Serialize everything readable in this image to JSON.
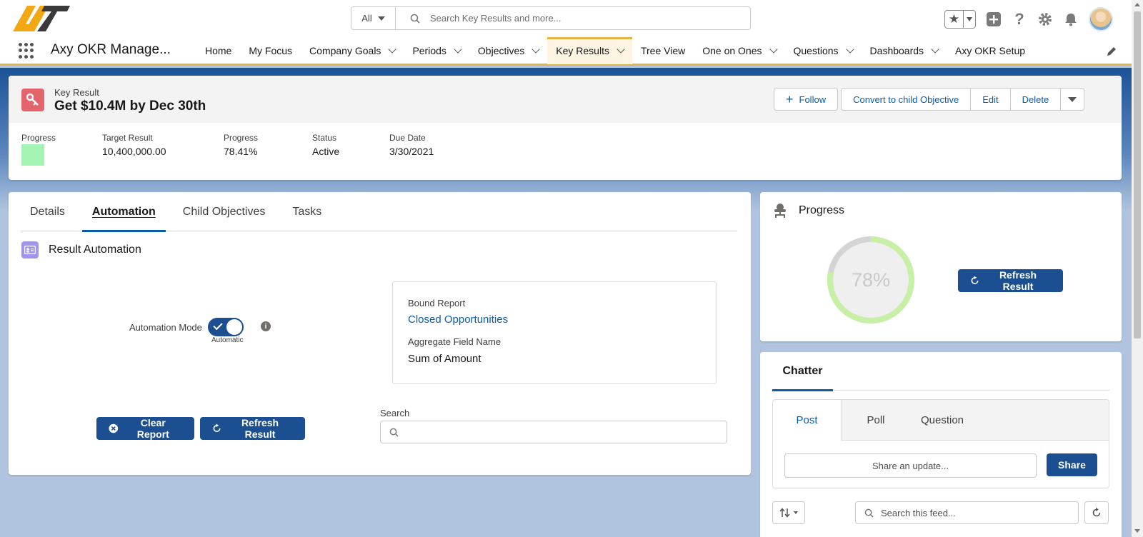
{
  "header": {
    "search_scope": "All",
    "search_placeholder": "Search Key Results and more...",
    "icons": [
      "favorites-star-icon",
      "add-icon",
      "help-icon",
      "setup-gear-icon",
      "notifications-bell-icon",
      "user-avatar"
    ]
  },
  "nav": {
    "app_name": "Axy OKR Manage...",
    "items": [
      {
        "label": "Home",
        "dropdown": false
      },
      {
        "label": "My Focus",
        "dropdown": false
      },
      {
        "label": "Company Goals",
        "dropdown": true
      },
      {
        "label": "Periods",
        "dropdown": true
      },
      {
        "label": "Objectives",
        "dropdown": true
      },
      {
        "label": "Key Results",
        "dropdown": true,
        "active": true
      },
      {
        "label": "Tree View",
        "dropdown": false
      },
      {
        "label": "One on Ones",
        "dropdown": true
      },
      {
        "label": "Questions",
        "dropdown": true
      },
      {
        "label": "Dashboards",
        "dropdown": true
      },
      {
        "label": "Axy OKR Setup",
        "dropdown": false
      }
    ]
  },
  "record": {
    "object_label": "Key Result",
    "title": "Get $10.4M by Dec 30th",
    "actions": {
      "follow": "Follow",
      "convert": "Convert to child Objective",
      "edit": "Edit",
      "delete": "Delete"
    },
    "highlights": {
      "progress_label": "Progress",
      "progress_color": "#a4f4b4",
      "target_label": "Target Result",
      "target_value": "10,400,000.00",
      "progress2_label": "Progress",
      "progress2_value": "78.41%",
      "status_label": "Status",
      "status_value": "Active",
      "due_label": "Due Date",
      "due_value": "3/30/2021"
    }
  },
  "main": {
    "tabs": [
      "Details",
      "Automation",
      "Child Objectives",
      "Tasks"
    ],
    "active_tab": "Automation",
    "section_title": "Result Automation",
    "automation_mode_label": "Automation Mode",
    "automation_mode_on": true,
    "automation_mode_caption": "Automatic",
    "bound_report_label": "Bound Report",
    "bound_report_value": "Closed Opportunities",
    "aggregate_label": "Aggregate Field Name",
    "aggregate_value": "Sum of Amount",
    "clear_report": "Clear Report",
    "refresh_result": "Refresh Result",
    "search_label": "Search",
    "search_placeholder": ""
  },
  "progress_card": {
    "title": "Progress",
    "percent_label": "78%",
    "percent": 78,
    "ring_color": "#c7efa6",
    "track_color": "#d4d4d4",
    "refresh_result": "Refresh Result"
  },
  "chatter": {
    "title": "Chatter",
    "publisher_tabs": [
      "Post",
      "Poll",
      "Question"
    ],
    "share_placeholder": "Share an update...",
    "share_button": "Share",
    "feed_search_placeholder": "Search this feed..."
  },
  "colors": {
    "brand": "#1b4f91",
    "link": "#0b5cab",
    "nav_accent": "#e3b44a",
    "key_result_icon": "#e3646b",
    "section_icon": "#a094ed"
  }
}
